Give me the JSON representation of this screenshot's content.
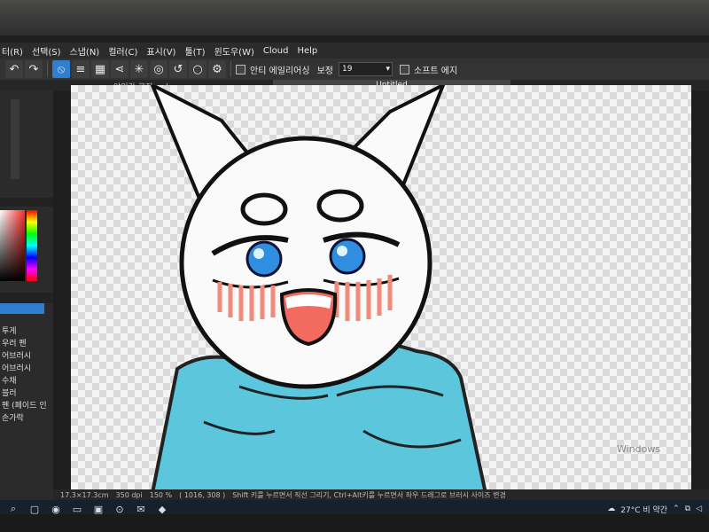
{
  "menu": {
    "items": [
      "터(R)",
      "선택(S)",
      "스냅(N)",
      "컬러(C)",
      "표시(V)",
      "툴(T)",
      "윈도우(W)",
      "Cloud",
      "Help"
    ]
  },
  "toolbar": {
    "antialias_label": "안티 에일리어싱",
    "correction_label": "보정",
    "correction_value": "19",
    "soft_edge_label": "소프트 에지"
  },
  "tabs": {
    "file_name": "야잉간 로지.mdp",
    "active_tab": "Untitled"
  },
  "brushes": {
    "items": [
      "투게",
      "우러 펜",
      "어브러시",
      "어브러시",
      "수채",
      "블러",
      "펜 (페이드 인/아",
      "손가락"
    ]
  },
  "status": {
    "dimensions": "17.3×17.3cm",
    "dpi": "350 dpi",
    "zoom": "150 %",
    "coords": "( 1016, 308 )",
    "hint": "Shift 키를 누르면서 직선 그리기, Ctrl+Alt키를 누르면서 좌우 드래그로 브러시 사이즈 변경"
  },
  "watermark": "Windows",
  "taskbar": {
    "weather": "27°C 비 약간"
  },
  "colors": {
    "hoodie": "#5bc6dc",
    "eye": "#2f8ee0",
    "blush": "#f08a7a",
    "accent": "#2f7fd0"
  }
}
